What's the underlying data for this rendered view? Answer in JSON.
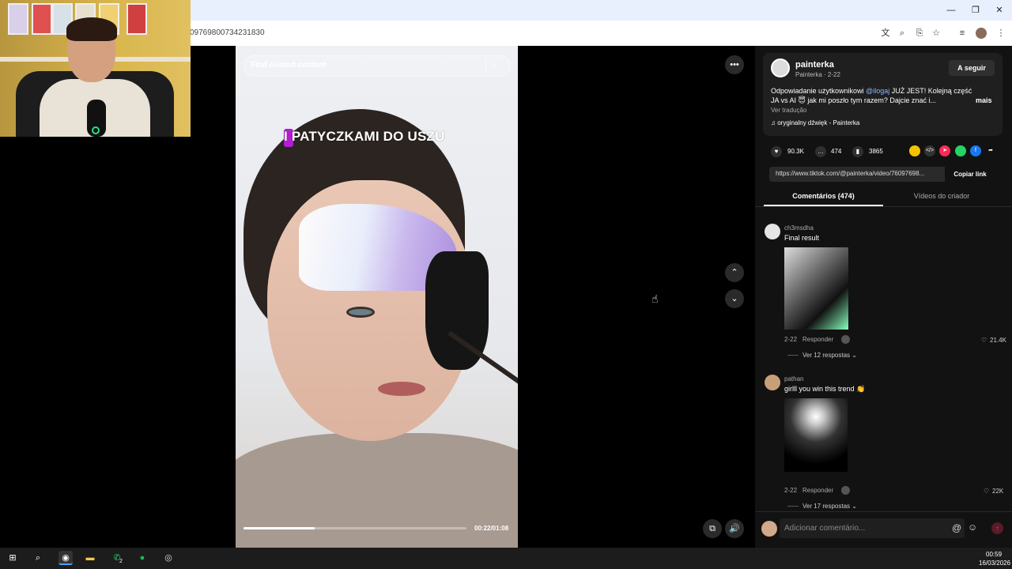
{
  "browser": {
    "url_visible": "09769800734231830",
    "window_controls": {
      "minimize": "—",
      "restore": "❐",
      "close": "✕"
    }
  },
  "video": {
    "search_placeholder": "Find related content",
    "caption": "I PATYCZKAMI DO USZU",
    "time": "00:22/01:08",
    "progress_fraction": 0.32
  },
  "post": {
    "author": "painterka",
    "author_sub": "Painterka · 2-22",
    "follow_label": "A seguir",
    "desc_part1": "Odpowiadanie użytkownikowi ",
    "mention": "@ilogaj",
    "desc_part2": " JUŻ JEST! Kolejną część",
    "desc_line2": "JA vs AI 😇 jak mi poszło tym razem? Dajcie znać i...",
    "more_label": "mais",
    "translate_label": "Ver tradução",
    "sound": "♫  oryginalny dźwięk - Painterka"
  },
  "stats": {
    "likes": "90.3K",
    "comments": "474",
    "saves": "3865"
  },
  "link": {
    "url": "https://www.tiktok.com/@painterka/video/76097698...",
    "copy_label": "Copiar link"
  },
  "tabs": {
    "comments": "Comentários (474)",
    "creator": "Vídeos do criador"
  },
  "comments": [
    {
      "user": "ch3msdha",
      "text": "Final result",
      "date": "2-22",
      "reply_label": "Responder",
      "likes": "21.4K",
      "replies": "Ver 12 respostas ⌄"
    },
    {
      "user": "pathan",
      "text": "girlll you win this trend 👏",
      "date": "2-22",
      "reply_label": "Responder",
      "likes": "22K",
      "replies": "Ver 17 respostas ⌄"
    }
  ],
  "composer": {
    "placeholder": "Adicionar comentário..."
  },
  "taskbar": {
    "time": "00:59",
    "date": "16/03/2026",
    "whatsapp_badge": "2"
  },
  "colors": {
    "accent_pink": "#fe2c55",
    "caption_purple": "#b01fd0",
    "mention": "#8ab4f8"
  }
}
